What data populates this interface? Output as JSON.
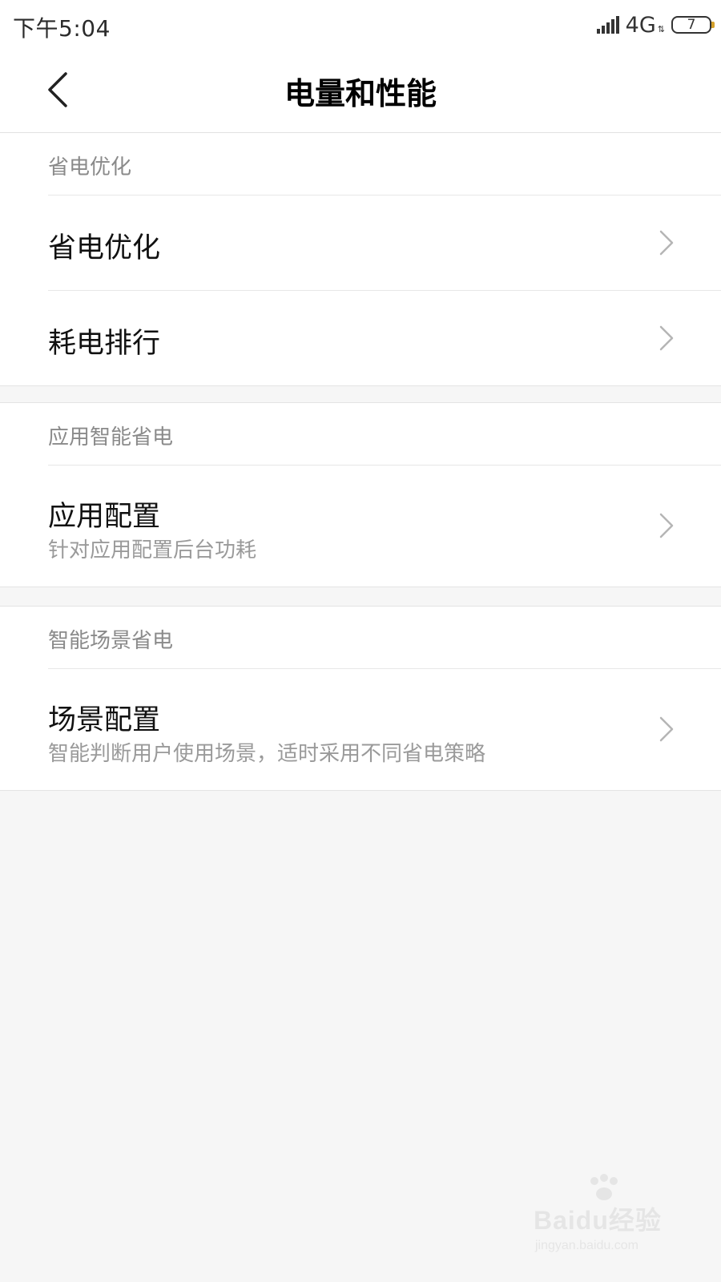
{
  "status_bar": {
    "time": "下午5:04",
    "network": "4G",
    "network_arrows": "⇅",
    "battery_level": "7",
    "signal_icon": "signal-bars-icon"
  },
  "header": {
    "title": "电量和性能",
    "back_icon": "chevron-left-icon"
  },
  "sections": [
    {
      "label": "省电优化",
      "items": [
        {
          "title": "省电优化",
          "subtitle": ""
        },
        {
          "title": "耗电排行",
          "subtitle": ""
        }
      ]
    },
    {
      "label": "应用智能省电",
      "items": [
        {
          "title": "应用配置",
          "subtitle": "针对应用配置后台功耗"
        }
      ]
    },
    {
      "label": "智能场景省电",
      "items": [
        {
          "title": "场景配置",
          "subtitle": "智能判断用户使用场景，适时采用不同省电策略"
        }
      ]
    }
  ],
  "watermark": {
    "brand": "Baidu经验",
    "url": "jingyan.baidu.com"
  },
  "colors": {
    "background": "#f6f6f6",
    "card": "#ffffff",
    "section_label": "#8a8a8a",
    "subtitle": "#9a9a9a",
    "chevron": "#b5b5b5",
    "battery_accent": "#d4a02a"
  }
}
